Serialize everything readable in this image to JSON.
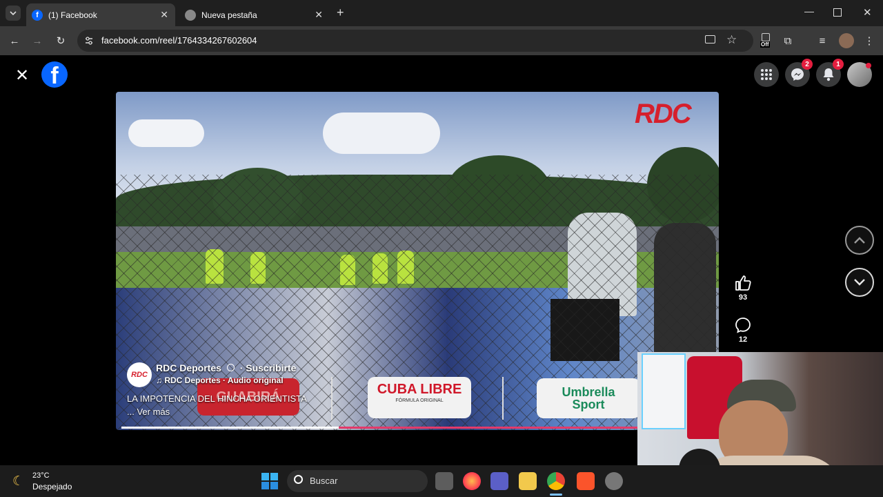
{
  "browser": {
    "tabs": [
      {
        "label": "(1) Facebook",
        "favicon": "facebook-icon",
        "active": true
      },
      {
        "label": "Nueva pestaña",
        "favicon": "chrome-icon",
        "active": false
      }
    ],
    "new_tab_label": "+",
    "url": "facebook.com/reel/1764334267602604",
    "extension_badge": "Off"
  },
  "facebook": {
    "messenger_badge": "2",
    "notifications_badge": "1"
  },
  "reel": {
    "watermark": "RDC",
    "author": "RDC Deportes",
    "subscribe": "· Suscribirte",
    "audio": "RDC Deportes · Audio original",
    "caption": "LA IMPOTENCIA DEL HINCHA ORIENTISTA",
    "see_more": "... Ver más",
    "likes": "93",
    "comments": "12",
    "progress": 0.42,
    "ads": [
      "GUABIRÁ",
      "CUBA LIBRE",
      "Umbrella Sport"
    ],
    "ad_sub": "FÓRMULA ORIGINAL",
    "avatar_text": "RDC"
  },
  "taskbar": {
    "weather_temp": "23°C",
    "weather_desc": "Despejado",
    "search_placeholder": "Buscar"
  },
  "colors": {
    "fb_blue": "#0866ff",
    "badge_red": "#e41e3f",
    "rdc_red": "#d61f2c"
  }
}
